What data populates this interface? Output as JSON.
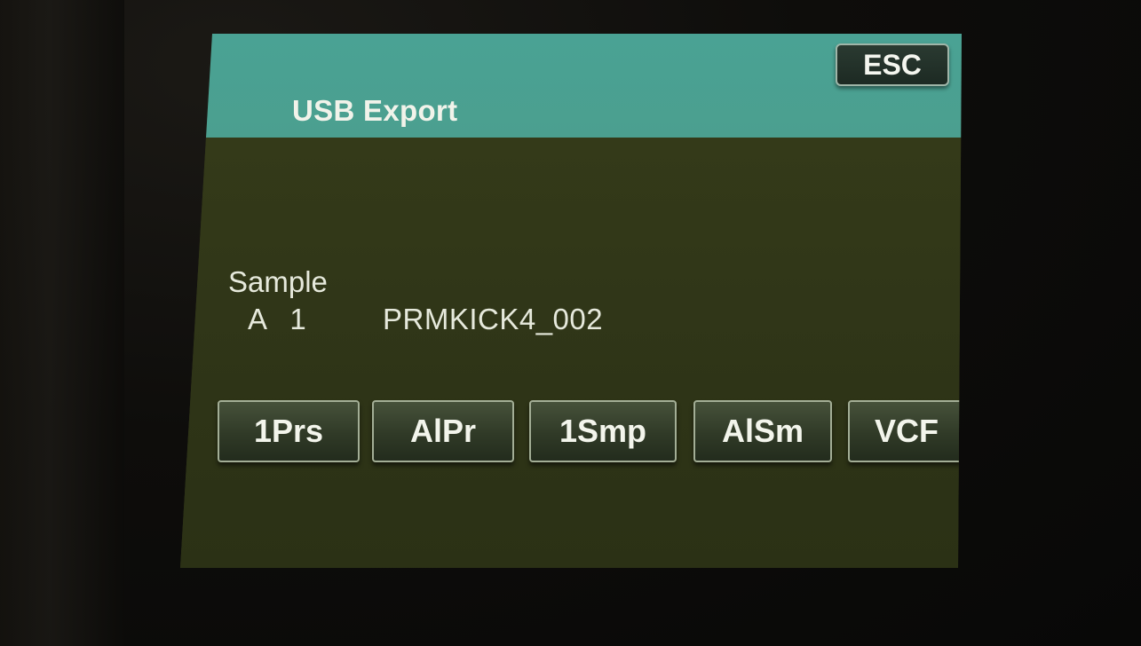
{
  "screen": {
    "title": "USB Export",
    "esc_label": "ESC"
  },
  "sample": {
    "label": "Sample",
    "slot": "A 1",
    "name": "PRMKICK4_002"
  },
  "softkeys": [
    {
      "label": "1Prs"
    },
    {
      "label": "AlPr"
    },
    {
      "label": "1Smp"
    },
    {
      "label": "AlSm"
    },
    {
      "label": "VCF"
    }
  ],
  "colors": {
    "header": "#4aa294",
    "background": "#2f3417",
    "text": "#e6e9dc"
  }
}
